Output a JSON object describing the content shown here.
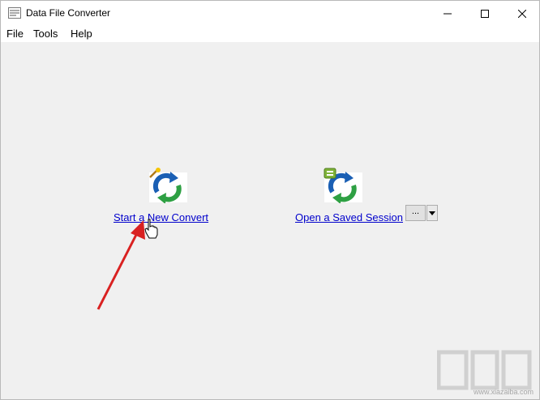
{
  "window": {
    "title": "Data File Converter"
  },
  "menu": {
    "file": "File",
    "tools": "Tools",
    "help": "Help"
  },
  "actions": {
    "new_convert": {
      "label": "Start a New Convert",
      "icon": "new-convert-icon"
    },
    "open_session": {
      "label": "Open a Saved Session",
      "icon": "saved-session-icon",
      "browse_label": "..."
    }
  },
  "watermark": {
    "text": "www.xiazaiba.com"
  },
  "colors": {
    "link": "#0000cc",
    "arrow": "#d92121",
    "icon_blue": "#1a5fb4",
    "icon_green": "#2ea043"
  }
}
